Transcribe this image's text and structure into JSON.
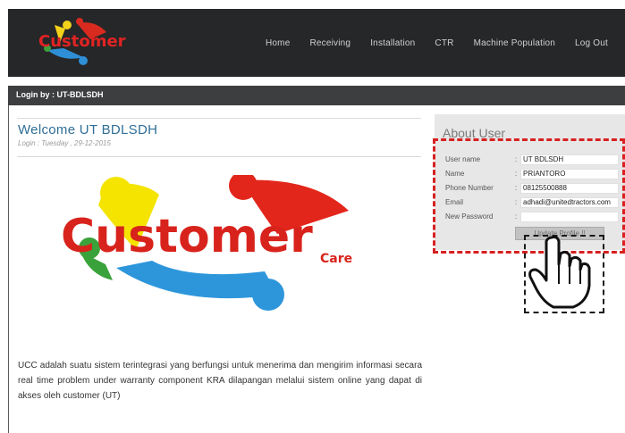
{
  "header": {
    "logo_text": "Customer",
    "nav": [
      "Home",
      "Receiving",
      "Installation",
      "CTR",
      "Machine Population",
      "Log Out"
    ]
  },
  "login_bar": {
    "text": "Login by : UT-BDLSDH"
  },
  "main": {
    "title": "Welcome UT BDLSDH",
    "subtitle": "Login : Tuesday , 29-12-2015",
    "image_text": {
      "big": "Customer",
      "small": "Care"
    },
    "description": "UCC adalah suatu sistem terintegrasi yang berfungsi untuk menerima dan mengirim informasi secara real time problem under warranty component KRA dilapangan melalui sistem online yang dapat di akses oleh customer (UT)"
  },
  "about_user": {
    "title": "About User",
    "fields": [
      {
        "label": "User name",
        "value": "UT BDLSDH"
      },
      {
        "label": "Name",
        "value": "PRIANTORO"
      },
      {
        "label": "Phone Number",
        "value": "08125500888"
      },
      {
        "label": "Email",
        "value": "adhadi@unitedtractors.com"
      },
      {
        "label": "New Password",
        "value": ""
      }
    ],
    "update_button": "Update Profile !!"
  },
  "colors": {
    "header_bg": "#262728",
    "accent_title": "#2f6e96",
    "highlight_dashes": "#d82020"
  },
  "icons": [
    "customer-care-logo",
    "pointing-hand-cursor"
  ]
}
